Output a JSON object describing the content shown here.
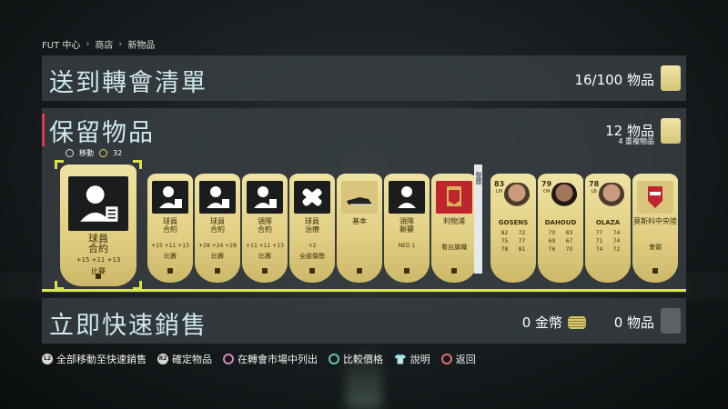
{
  "breadcrumb": [
    "FUT 中心",
    "商店",
    "新物品"
  ],
  "transfer_list": {
    "title": "送到轉會清單",
    "count": "16/100 物品"
  },
  "store": {
    "title": "保留物品",
    "count": "12 物品",
    "sub": "4 重複物品",
    "move_label": "移動",
    "coin_count": "32"
  },
  "cards": [
    {
      "l1": "球員\n合約",
      "l2": "+15  +11  +13",
      "l3": "比賽"
    },
    {
      "l1": "球員\n合約",
      "l2": "+15 +11 +13",
      "l3": "比賽"
    },
    {
      "l1": "球員\n合約",
      "l2": "+28 +24 +28",
      "l3": "比賽"
    },
    {
      "l1": "領隊\n合約",
      "l2": "+11 +11 +13",
      "l3": "比賽"
    },
    {
      "l1": "球員\n治療",
      "l2": "+2",
      "l3": "全部傷勢"
    },
    {
      "l1": "基本",
      "l2": "",
      "l3": ""
    },
    {
      "l1": "領隊\n聯賽",
      "l2": "NED 1",
      "l3": ""
    },
    {
      "l1": "利物浦",
      "l2": "",
      "l3": "看台旗幟"
    }
  ],
  "players": [
    {
      "rating": "83",
      "pos": "LM",
      "name": "GOSENS",
      "stats": [
        "82",
        "72",
        "75",
        "77",
        "78",
        "81"
      ]
    },
    {
      "rating": "79",
      "pos": "CM",
      "name": "DAHOUD",
      "stats": [
        "70",
        "83",
        "69",
        "67",
        "76",
        "70"
      ]
    },
    {
      "rating": "78",
      "pos": "LB",
      "name": "OLAZA",
      "stats": [
        "77",
        "74",
        "71",
        "74",
        "74",
        "72"
      ]
    }
  ],
  "club_card": {
    "name": "莫斯科中央陸",
    "sub": "會徽"
  },
  "side_tab": "整體",
  "quicksell": {
    "title": "立即快速銷售",
    "coins": "0 金幣",
    "items": "0 物品"
  },
  "hints": [
    "全部移動至快速銷售",
    "確定物品",
    "在轉會市場中列出",
    "比較價格",
    "說明",
    "返回"
  ]
}
